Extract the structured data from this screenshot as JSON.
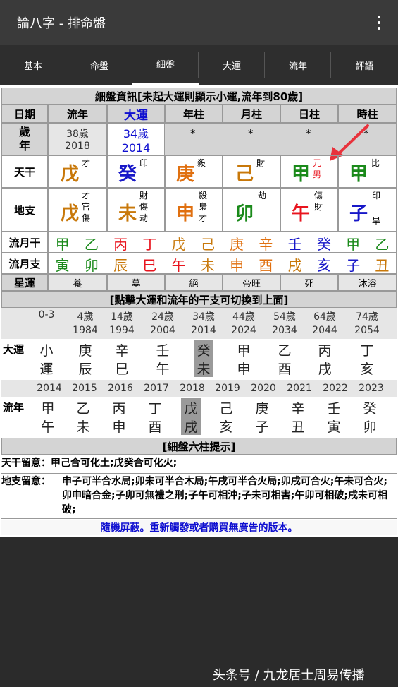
{
  "app": {
    "title": "論八字 - 排命盤"
  },
  "tabs": [
    "基本",
    "命盤",
    "細盤",
    "大運",
    "流年",
    "評語"
  ],
  "active_tab": 2,
  "banner1": "細盤資訊[未起大運則顯示小運,流年到80歲]",
  "columns": [
    "日期",
    "流年",
    "大運",
    "年柱",
    "月柱",
    "日柱",
    "時柱"
  ],
  "age_row": {
    "label": "歲年",
    "liunian_age": "38歲",
    "liunian_year": "2018",
    "dayun_age": "34歲",
    "dayun_year": "2014",
    "stars": [
      "*",
      "*",
      "*",
      "*"
    ]
  },
  "tiangan": {
    "label": "天干",
    "chars": [
      "戊",
      "癸",
      "庚",
      "己",
      "甲",
      "甲"
    ],
    "gods": [
      "才",
      "印",
      "殺",
      "財",
      "元",
      "比"
    ],
    "extra": "男"
  },
  "dizhi": {
    "label": "地支",
    "chars": [
      "戊",
      "未",
      "申",
      "卯",
      "午",
      "子"
    ],
    "gods": [
      [
        "才",
        "官",
        "傷"
      ],
      [
        "財",
        "傷",
        "劫"
      ],
      [
        "殺",
        "梟",
        "才"
      ],
      [
        "劫"
      ],
      [
        "傷",
        "財"
      ],
      [
        "印",
        "",
        "旱"
      ]
    ]
  },
  "liuyue_gan": {
    "label": "流月干",
    "chars": [
      "甲",
      "乙",
      "丙",
      "丁",
      "戊",
      "己",
      "庚",
      "辛",
      "壬",
      "癸",
      "甲",
      "乙"
    ]
  },
  "liuyue_zhi": {
    "label": "流月支",
    "chars": [
      "寅",
      "卯",
      "辰",
      "巳",
      "午",
      "未",
      "申",
      "酉",
      "戌",
      "亥",
      "子",
      "丑"
    ]
  },
  "xingyun": {
    "label": "星運",
    "vals": [
      "養",
      "墓",
      "絕",
      "帝旺",
      "死",
      "沐浴"
    ]
  },
  "banner2": "[點擊大運和流年的干支可切換到上面]",
  "dayun": {
    "label": "大運",
    "ages": [
      "0-3",
      "4歲",
      "14歲",
      "24歲",
      "34歲",
      "44歲",
      "54歲",
      "64歲",
      "74歲"
    ],
    "years": [
      "",
      "1984",
      "1994",
      "2004",
      "2014",
      "2024",
      "2034",
      "2044",
      "2054"
    ],
    "gan": [
      "小",
      "庚",
      "辛",
      "壬",
      "癸",
      "甲",
      "乙",
      "丙",
      "丁"
    ],
    "zhi": [
      "運",
      "辰",
      "巳",
      "午",
      "未",
      "申",
      "酉",
      "戌",
      "亥"
    ]
  },
  "liunian": {
    "label": "流年",
    "years": [
      "2014",
      "2015",
      "2016",
      "2017",
      "2018",
      "2019",
      "2020",
      "2021",
      "2022",
      "2023"
    ],
    "gan": [
      "甲",
      "乙",
      "丙",
      "丁",
      "戊",
      "己",
      "庚",
      "辛",
      "壬",
      "癸"
    ],
    "zhi": [
      "午",
      "未",
      "申",
      "酉",
      "戌",
      "亥",
      "子",
      "丑",
      "寅",
      "卯"
    ]
  },
  "banner3": "[細盤六柱提示]",
  "tg_note": {
    "label": "天干留意：",
    "text": "甲己合可化土;戊癸合可化火;"
  },
  "dz_note": {
    "label": "地支留意：",
    "text": "申子可半合水局;卯未可半合木局;午戌可半合火局;卯戌可合火;午未可合火;卯申暗合金;子卯可無禮之刑;子午可相沖;子未可相害;午卯可相破;戌未可相破;"
  },
  "ad": "隨機屏蔽。重新觸發或者購買無廣告的版本。",
  "watermark": "头条号 / 九龙居士周易传播",
  "colors": {
    "wood": "#1a8a1a",
    "fire": "#e8141e",
    "earth": "#c8780a",
    "metal": "#e07010",
    "water": "#1818c8",
    "dark": "#333333",
    "blue": "#1010d0",
    "accent": "#e8323c"
  }
}
